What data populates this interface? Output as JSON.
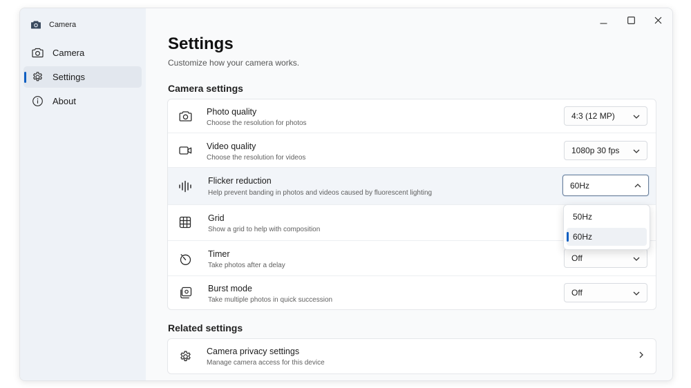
{
  "app": {
    "title": "Camera",
    "icon": "camera-icon"
  },
  "window_controls": {
    "minimize": "minimize-icon",
    "maximize": "maximize-icon",
    "close": "close-icon"
  },
  "sidebar": {
    "items": [
      {
        "label": "Camera",
        "icon": "camera-icon",
        "active": false
      },
      {
        "label": "Settings",
        "icon": "gear-icon",
        "active": true
      },
      {
        "label": "About",
        "icon": "info-icon",
        "active": false
      }
    ]
  },
  "page": {
    "title": "Settings",
    "subtitle": "Customize how your camera works."
  },
  "camera_settings": {
    "heading": "Camera settings",
    "rows": [
      {
        "title": "Photo quality",
        "description": "Choose the resolution for photos",
        "value": "4:3 (12 MP)",
        "icon": "camera-icon"
      },
      {
        "title": "Video quality",
        "description": "Choose the resolution for videos",
        "value": "1080p 30 fps",
        "icon": "video-camera-icon"
      },
      {
        "title": "Flicker reduction",
        "description": "Help prevent banding in photos and videos caused by fluorescent lighting",
        "value": "60Hz",
        "icon": "waveform-icon",
        "open": true
      },
      {
        "title": "Grid",
        "description": "Show a grid to help with composition",
        "icon": "grid-icon"
      },
      {
        "title": "Timer",
        "description": "Take photos after a delay",
        "value": "Off",
        "icon": "timer-icon"
      },
      {
        "title": "Burst mode",
        "description": "Take multiple photos in quick succession",
        "value": "Off",
        "icon": "burst-icon"
      }
    ]
  },
  "flicker_dropdown": {
    "options": [
      "50Hz",
      "60Hz"
    ],
    "selected": "60Hz"
  },
  "related_settings": {
    "heading": "Related settings",
    "rows": [
      {
        "title": "Camera privacy settings",
        "description": "Manage camera access for this device",
        "icon": "gear-icon"
      }
    ]
  },
  "colors": {
    "accent": "#0f5fc2",
    "sidebar_bg": "#eef2f7",
    "content_bg": "#f9fafb"
  }
}
